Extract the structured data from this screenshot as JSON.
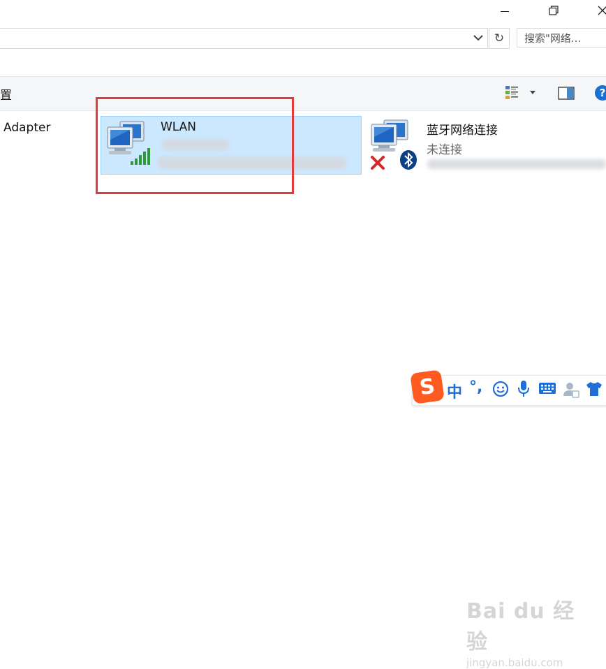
{
  "window": {
    "minimize_glyph": "—",
    "restore_glyph": "❐",
    "close_glyph": "✕"
  },
  "address_bar": {
    "refresh_glyph": "↻",
    "search_placeholder": "搜索\"网络..."
  },
  "command_bar": {
    "left_label": "置"
  },
  "items": [
    {
      "partial_label": "Adapter"
    },
    {
      "name": "WLAN",
      "status": "",
      "selected": true
    },
    {
      "name": "蓝牙网络连接",
      "status": "未连接",
      "selected": false
    }
  ],
  "ime_toolbar": {
    "logo": "S",
    "mode": "中",
    "punct": "°,"
  },
  "watermark": {
    "line1": "Bai du 经验",
    "line2": "jingyan.baidu.com"
  },
  "colors": {
    "selection_fill": "#cce8ff",
    "selection_border": "#99d1ff",
    "highlight_box": "#e33b3b",
    "ime_blue": "#1e6ed8",
    "ime_logo": "#ff5a1f"
  }
}
